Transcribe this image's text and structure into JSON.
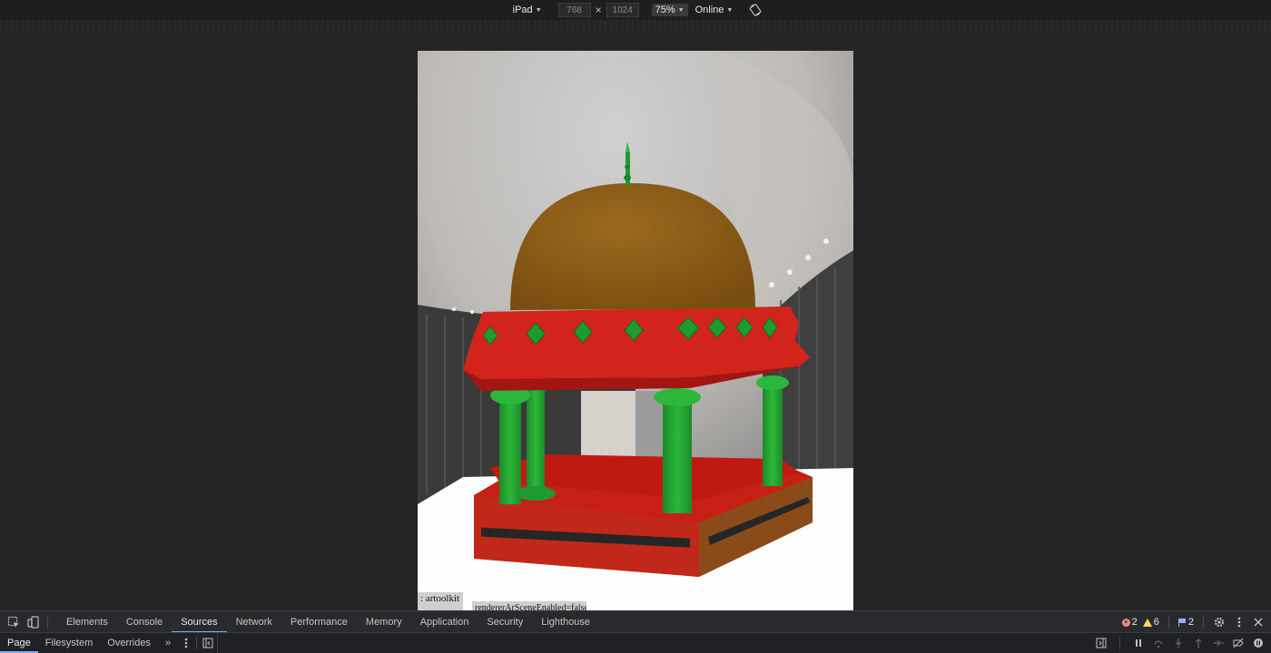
{
  "device_toolbar": {
    "device": "iPad",
    "width_value": "768",
    "height_value": "1024",
    "times": "×",
    "zoom": "75%",
    "throttle": "Online"
  },
  "viewport": {
    "labels": [
      ": artoolkit",
      "rendererArSceneEnabled=false"
    ]
  },
  "devtools": {
    "tabs": [
      "Elements",
      "Console",
      "Sources",
      "Network",
      "Performance",
      "Memory",
      "Application",
      "Security",
      "Lighthouse"
    ],
    "active_tab": "Sources",
    "errors": "2",
    "warnings": "6",
    "issues": "2"
  },
  "sources": {
    "subtabs": [
      "Page",
      "Filesystem",
      "Overrides"
    ],
    "more": "»"
  }
}
